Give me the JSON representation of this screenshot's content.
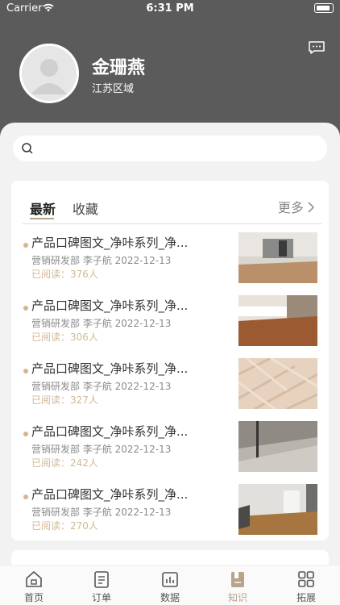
{
  "status_bar": {
    "carrier": "Carrier",
    "time": "6:31 PM"
  },
  "profile": {
    "name": "金珊燕",
    "region": "江苏区域"
  },
  "search": {
    "placeholder": ""
  },
  "tabs": {
    "latest": "最新",
    "favorite": "收藏",
    "more": "更多"
  },
  "articles": [
    {
      "title": "产品口碑图文_净咔系列_净...",
      "meta": "营销研发部 李子航 2022-12-13",
      "read": "已阅读：376人"
    },
    {
      "title": "产品口碑图文_净咔系列_净...",
      "meta": "营销研发部 李子航 2022-12-13",
      "read": "已阅读：306人"
    },
    {
      "title": "产品口碑图文_净咔系列_净...",
      "meta": "营销研发部 李子航 2022-12-13",
      "read": "已阅读：327人"
    },
    {
      "title": "产品口碑图文_净咔系列_净...",
      "meta": "营销研发部 李子航 2022-12-13",
      "read": "已阅读：242人"
    },
    {
      "title": "产品口碑图文_净咔系列_净...",
      "meta": "营销研发部 李子航 2022-12-13",
      "read": "已阅读：270人"
    }
  ],
  "tabbar": [
    {
      "label": "首页",
      "icon": "home-icon"
    },
    {
      "label": "订单",
      "icon": "order-icon"
    },
    {
      "label": "数据",
      "icon": "chart-icon"
    },
    {
      "label": "知识",
      "icon": "book-icon"
    },
    {
      "label": "拓展",
      "icon": "grid-icon"
    }
  ],
  "colors": {
    "header": "#5b5b5b",
    "accent": "#b7a48c",
    "read": "#d2b896"
  }
}
